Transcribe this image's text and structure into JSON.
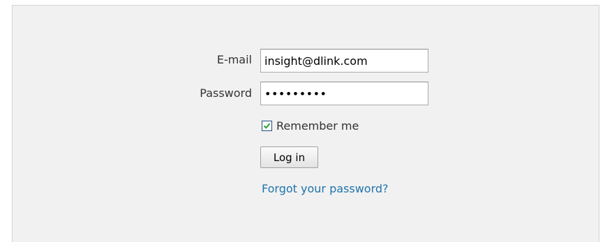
{
  "form": {
    "email_label": "E-mail",
    "email_value": "insight@dlink.com",
    "password_label": "Password",
    "password_value": "•••••••••",
    "remember_label": "Remember me",
    "remember_checked": true,
    "login_label": "Log in",
    "forgot_label": "Forgot your password?"
  },
  "colors": {
    "panel_bg": "#f1f1f1",
    "link": "#1f74ab",
    "check_mark": "#2e9e2e"
  }
}
